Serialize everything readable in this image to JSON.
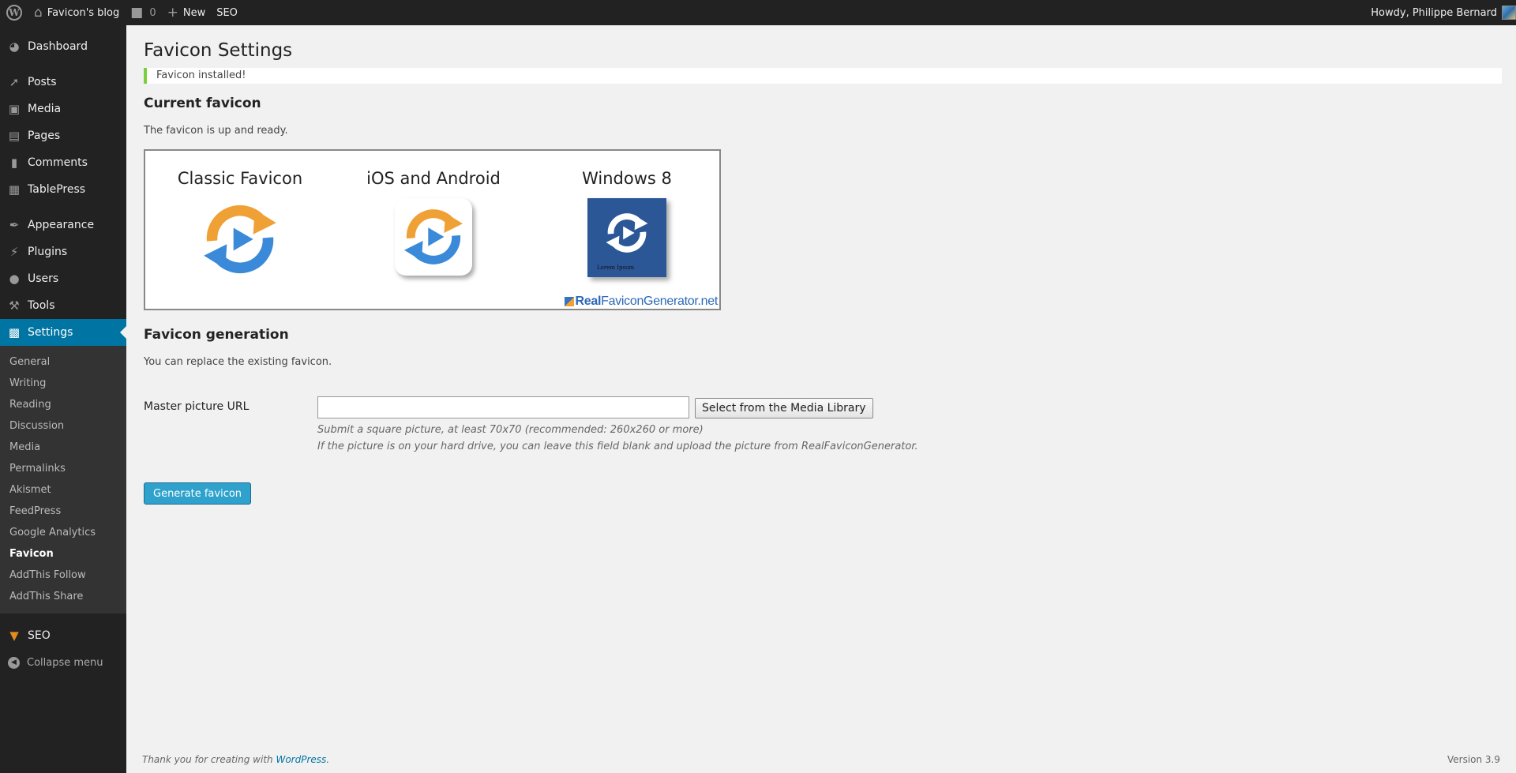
{
  "adminbar": {
    "site_name": "Favicon's blog",
    "comments_count": "0",
    "new_label": "New",
    "seo_label": "SEO",
    "greeting": "Howdy, Philippe Bernard"
  },
  "sidebar": {
    "items": [
      {
        "label": "Dashboard",
        "icon": "dashboard-icon"
      },
      {
        "label": "Posts",
        "icon": "pin-icon"
      },
      {
        "label": "Media",
        "icon": "media-icon"
      },
      {
        "label": "Pages",
        "icon": "pages-icon"
      },
      {
        "label": "Comments",
        "icon": "comments-icon"
      },
      {
        "label": "TablePress",
        "icon": "table-icon"
      },
      {
        "label": "Appearance",
        "icon": "brush-icon"
      },
      {
        "label": "Plugins",
        "icon": "plug-icon"
      },
      {
        "label": "Users",
        "icon": "users-icon"
      },
      {
        "label": "Tools",
        "icon": "wrench-icon"
      },
      {
        "label": "Settings",
        "icon": "settings-icon"
      }
    ],
    "submenu": [
      "General",
      "Writing",
      "Reading",
      "Discussion",
      "Media",
      "Permalinks",
      "Akismet",
      "FeedPress",
      "Google Analytics",
      "Favicon",
      "AddThis Follow",
      "AddThis Share"
    ],
    "seo_label": "SEO",
    "collapse_label": "Collapse menu"
  },
  "page": {
    "title": "Favicon Settings",
    "notice": "Favicon installed!",
    "current_heading": "Current favicon",
    "current_text": "The favicon is up and ready.",
    "preview": {
      "classic_title": "Classic Favicon",
      "ios_title": "iOS and Android",
      "windows_title": "Windows 8",
      "tile_label": "Lorem Ipsum",
      "logo_real": "Real",
      "logo_rest": "FaviconGenerator.net"
    },
    "generation_heading": "Favicon generation",
    "generation_text": "You can replace the existing favicon.",
    "master_label": "Master picture URL",
    "master_value": "",
    "select_button": "Select from the Media Library",
    "hint1": "Submit a square picture, at least 70x70 (recommended: 260x260 or more)",
    "hint2": "If the picture is on your hard drive, you can leave this field blank and upload the picture from RealFaviconGenerator.",
    "generate_button": "Generate favicon"
  },
  "footer": {
    "thanks_prefix": "Thank you for creating with ",
    "wordpress_link": "WordPress",
    "thanks_suffix": ".",
    "version": "Version 3.9"
  },
  "colors": {
    "adminbar_bg": "#222222",
    "current_menu": "#0074a2",
    "notice_border": "#7ad03a",
    "primary_button": "#2ea2cc",
    "favicon_orange": "#f0a136",
    "favicon_blue": "#3b8ad9",
    "tile_blue": "#2b5797"
  }
}
